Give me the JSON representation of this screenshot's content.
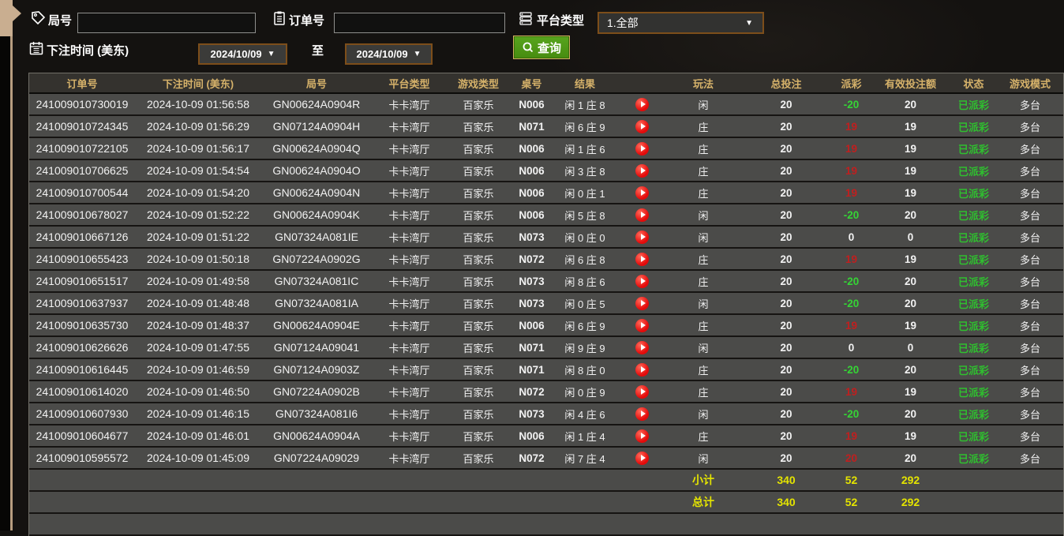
{
  "filters": {
    "round_label": "局号",
    "round_value": "",
    "order_label": "订单号",
    "order_value": "",
    "platform_label": "平台类型",
    "platform_selected": "1.全部",
    "bet_time_label": "下注时间 (美东)",
    "date_from": "2024/10/09",
    "date_to": "2024/10/09",
    "to_label": "至",
    "query_label": "查询",
    "caret": "▼"
  },
  "icons": {
    "round": "tag-icon",
    "order": "clipboard-icon",
    "platform": "server-list-icon",
    "bet_time": "calendar-icon",
    "query": "magnifier-icon",
    "result": "play-video-icon"
  },
  "colors": {
    "header_text": "#d6b26a",
    "payout_win_red": "#c01f1f",
    "payout_loss_green": "#35d435",
    "status_paid_green": "#2fbf2f",
    "summary_yellow": "#e4e400",
    "query_button_green": "#4f9c16",
    "dropdown_border_brown": "#7d4e1a",
    "row_bg": "#4b4b49",
    "left_tab_tan": "#c9ae90"
  },
  "table": {
    "headers": [
      "订单号",
      "下注时间 (美东)",
      "局号",
      "平台类型",
      "游戏类型",
      "桌号",
      "结果",
      "",
      "玩法",
      "总投注",
      "派彩",
      "有效投注额",
      "状态",
      "游戏模式"
    ],
    "rows": [
      {
        "order": "241009010730019",
        "time": "2024-10-09 01:56:58",
        "round": "GN00624A0904R",
        "platform": "卡卡湾厅",
        "game_type": "百家乐",
        "table_no": "N006",
        "result": "闲 1 庄 8",
        "play_type": "闲",
        "total_bet": "20",
        "payout": "-20",
        "payout_color": "green",
        "valid_bet": "20",
        "status": "已派彩",
        "mode": "多台"
      },
      {
        "order": "241009010724345",
        "time": "2024-10-09 01:56:29",
        "round": "GN07124A0904H",
        "platform": "卡卡湾厅",
        "game_type": "百家乐",
        "table_no": "N071",
        "result": "闲 6 庄 9",
        "play_type": "庄",
        "total_bet": "20",
        "payout": "19",
        "payout_color": "red",
        "valid_bet": "19",
        "status": "已派彩",
        "mode": "多台"
      },
      {
        "order": "241009010722105",
        "time": "2024-10-09 01:56:17",
        "round": "GN00624A0904Q",
        "platform": "卡卡湾厅",
        "game_type": "百家乐",
        "table_no": "N006",
        "result": "闲 1 庄 6",
        "play_type": "庄",
        "total_bet": "20",
        "payout": "19",
        "payout_color": "red",
        "valid_bet": "19",
        "status": "已派彩",
        "mode": "多台"
      },
      {
        "order": "241009010706625",
        "time": "2024-10-09 01:54:54",
        "round": "GN00624A0904O",
        "platform": "卡卡湾厅",
        "game_type": "百家乐",
        "table_no": "N006",
        "result": "闲 3 庄 8",
        "play_type": "庄",
        "total_bet": "20",
        "payout": "19",
        "payout_color": "red",
        "valid_bet": "19",
        "status": "已派彩",
        "mode": "多台"
      },
      {
        "order": "241009010700544",
        "time": "2024-10-09 01:54:20",
        "round": "GN00624A0904N",
        "platform": "卡卡湾厅",
        "game_type": "百家乐",
        "table_no": "N006",
        "result": "闲 0 庄 1",
        "play_type": "庄",
        "total_bet": "20",
        "payout": "19",
        "payout_color": "red",
        "valid_bet": "19",
        "status": "已派彩",
        "mode": "多台"
      },
      {
        "order": "241009010678027",
        "time": "2024-10-09 01:52:22",
        "round": "GN00624A0904K",
        "platform": "卡卡湾厅",
        "game_type": "百家乐",
        "table_no": "N006",
        "result": "闲 5 庄 8",
        "play_type": "闲",
        "total_bet": "20",
        "payout": "-20",
        "payout_color": "green",
        "valid_bet": "20",
        "status": "已派彩",
        "mode": "多台"
      },
      {
        "order": "241009010667126",
        "time": "2024-10-09 01:51:22",
        "round": "GN07324A081IE",
        "platform": "卡卡湾厅",
        "game_type": "百家乐",
        "table_no": "N073",
        "result": "闲 0 庄 0",
        "play_type": "闲",
        "total_bet": "20",
        "payout": "0",
        "payout_color": "white",
        "valid_bet": "0",
        "status": "已派彩",
        "mode": "多台"
      },
      {
        "order": "241009010655423",
        "time": "2024-10-09 01:50:18",
        "round": "GN07224A0902G",
        "platform": "卡卡湾厅",
        "game_type": "百家乐",
        "table_no": "N072",
        "result": "闲 6 庄 8",
        "play_type": "庄",
        "total_bet": "20",
        "payout": "19",
        "payout_color": "red",
        "valid_bet": "19",
        "status": "已派彩",
        "mode": "多台"
      },
      {
        "order": "241009010651517",
        "time": "2024-10-09 01:49:58",
        "round": "GN07324A081IC",
        "platform": "卡卡湾厅",
        "game_type": "百家乐",
        "table_no": "N073",
        "result": "闲 8 庄 6",
        "play_type": "庄",
        "total_bet": "20",
        "payout": "-20",
        "payout_color": "green",
        "valid_bet": "20",
        "status": "已派彩",
        "mode": "多台"
      },
      {
        "order": "241009010637937",
        "time": "2024-10-09 01:48:48",
        "round": "GN07324A081IA",
        "platform": "卡卡湾厅",
        "game_type": "百家乐",
        "table_no": "N073",
        "result": "闲 0 庄 5",
        "play_type": "闲",
        "total_bet": "20",
        "payout": "-20",
        "payout_color": "green",
        "valid_bet": "20",
        "status": "已派彩",
        "mode": "多台"
      },
      {
        "order": "241009010635730",
        "time": "2024-10-09 01:48:37",
        "round": "GN00624A0904E",
        "platform": "卡卡湾厅",
        "game_type": "百家乐",
        "table_no": "N006",
        "result": "闲 6 庄 9",
        "play_type": "庄",
        "total_bet": "20",
        "payout": "19",
        "payout_color": "red",
        "valid_bet": "19",
        "status": "已派彩",
        "mode": "多台"
      },
      {
        "order": "241009010626626",
        "time": "2024-10-09 01:47:55",
        "round": "GN07124A09041",
        "platform": "卡卡湾厅",
        "game_type": "百家乐",
        "table_no": "N071",
        "result": "闲 9 庄 9",
        "play_type": "闲",
        "total_bet": "20",
        "payout": "0",
        "payout_color": "white",
        "valid_bet": "0",
        "status": "已派彩",
        "mode": "多台"
      },
      {
        "order": "241009010616445",
        "time": "2024-10-09 01:46:59",
        "round": "GN07124A0903Z",
        "platform": "卡卡湾厅",
        "game_type": "百家乐",
        "table_no": "N071",
        "result": "闲 8 庄 0",
        "play_type": "庄",
        "total_bet": "20",
        "payout": "-20",
        "payout_color": "green",
        "valid_bet": "20",
        "status": "已派彩",
        "mode": "多台"
      },
      {
        "order": "241009010614020",
        "time": "2024-10-09 01:46:50",
        "round": "GN07224A0902B",
        "platform": "卡卡湾厅",
        "game_type": "百家乐",
        "table_no": "N072",
        "result": "闲 0 庄 9",
        "play_type": "庄",
        "total_bet": "20",
        "payout": "19",
        "payout_color": "red",
        "valid_bet": "19",
        "status": "已派彩",
        "mode": "多台"
      },
      {
        "order": "241009010607930",
        "time": "2024-10-09 01:46:15",
        "round": "GN07324A081I6",
        "platform": "卡卡湾厅",
        "game_type": "百家乐",
        "table_no": "N073",
        "result": "闲 4 庄 6",
        "play_type": "闲",
        "total_bet": "20",
        "payout": "-20",
        "payout_color": "green",
        "valid_bet": "20",
        "status": "已派彩",
        "mode": "多台"
      },
      {
        "order": "241009010604677",
        "time": "2024-10-09 01:46:01",
        "round": "GN00624A0904A",
        "platform": "卡卡湾厅",
        "game_type": "百家乐",
        "table_no": "N006",
        "result": "闲 1 庄 4",
        "play_type": "庄",
        "total_bet": "20",
        "payout": "19",
        "payout_color": "red",
        "valid_bet": "19",
        "status": "已派彩",
        "mode": "多台"
      },
      {
        "order": "241009010595572",
        "time": "2024-10-09 01:45:09",
        "round": "GN07224A09029",
        "platform": "卡卡湾厅",
        "game_type": "百家乐",
        "table_no": "N072",
        "result": "闲 7 庄 4",
        "play_type": "闲",
        "total_bet": "20",
        "payout": "20",
        "payout_color": "red",
        "valid_bet": "20",
        "status": "已派彩",
        "mode": "多台"
      }
    ],
    "subtotal": {
      "label": "小计",
      "total_bet": "340",
      "payout": "52",
      "valid_bet": "292"
    },
    "grand_total": {
      "label": "总计",
      "total_bet": "340",
      "payout": "52",
      "valid_bet": "292"
    }
  }
}
